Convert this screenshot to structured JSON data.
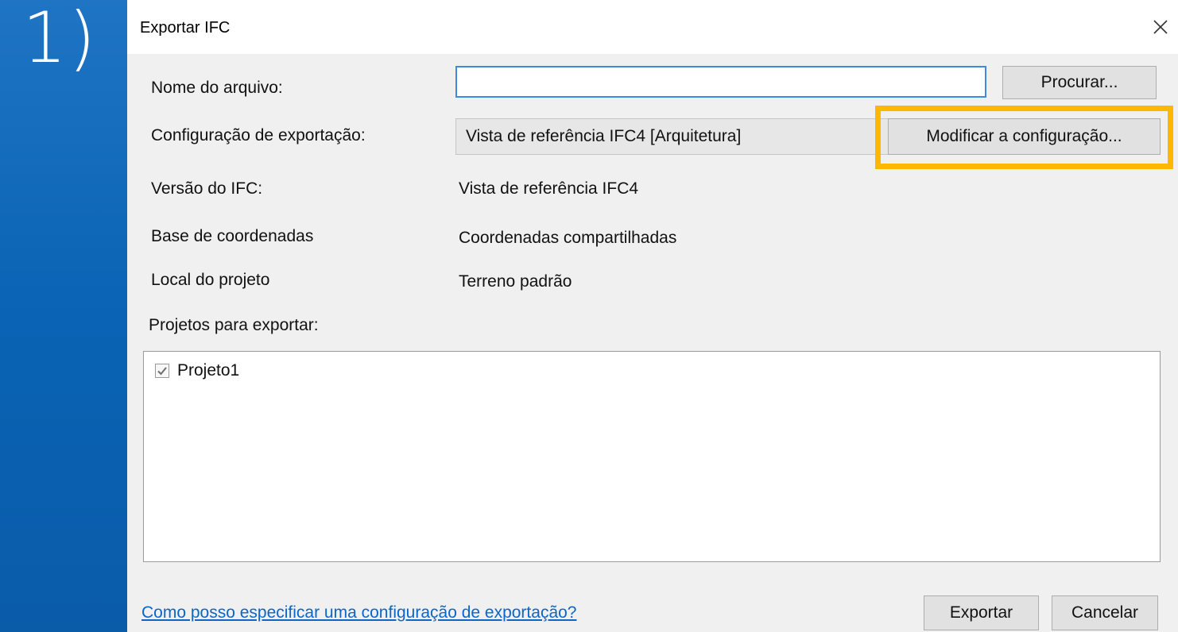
{
  "step": "1)",
  "dialog": {
    "title": "Exportar IFC",
    "fields": {
      "file_name_label": "Nome do arquivo:",
      "file_name_value": "",
      "browse_button": "Procurar...",
      "export_config_label": "Configuração de exportação:",
      "export_config_selected": "Vista de referência IFC4 [Arquitetura]",
      "modify_config_button": "Modificar a configuração...",
      "ifc_version_label": "Versão do IFC:",
      "ifc_version_value": "Vista de referência IFC4",
      "coord_base_label": "Base de coordenadas",
      "coord_base_value": "Coordenadas compartilhadas",
      "project_location_label": "Local do projeto",
      "project_location_value": "Terreno padrão",
      "projects_label": "Projetos para exportar:"
    },
    "projects": [
      {
        "name": "Projeto1",
        "checked": true
      }
    ],
    "help_link": "Como posso especificar uma configuração de exportação?",
    "export_button": "Exportar",
    "cancel_button": "Cancelar"
  },
  "colors": {
    "background": "#0a63b4",
    "highlight": "#ffb700",
    "link": "#0b66c8",
    "input_focus": "#3f8ae0"
  },
  "icons": {
    "close": "close-icon",
    "dropdown": "chevron-down-icon",
    "check": "checkmark-icon"
  }
}
